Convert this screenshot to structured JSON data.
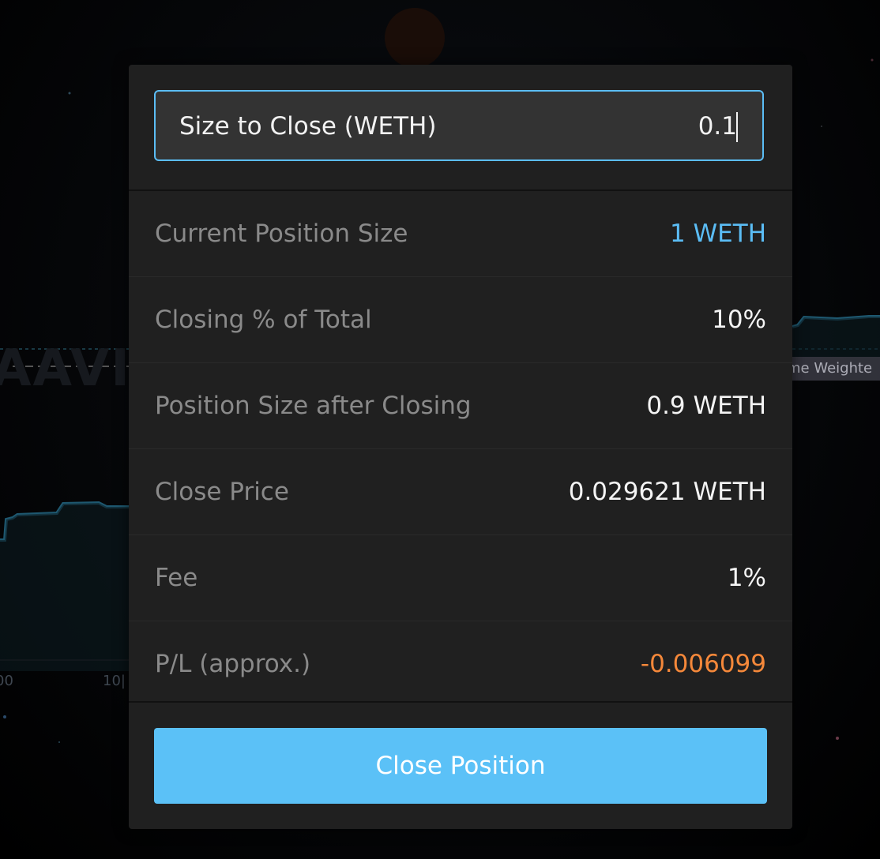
{
  "background": {
    "legend_label_partial": "me Weighte",
    "tick_labels": [
      "00",
      "10|"
    ],
    "watermark": "AAVI"
  },
  "modal": {
    "size_input": {
      "label": "Size to Close (WETH)",
      "value": "0.1"
    },
    "rows": [
      {
        "label": "Current Position Size",
        "value": "1 WETH",
        "value_color": "#5bbdf5"
      },
      {
        "label": "Closing % of Total",
        "value": "10%",
        "value_color": "#f4f4f4"
      },
      {
        "label": "Position Size after Closing",
        "value": "0.9 WETH",
        "value_color": "#f4f4f4"
      },
      {
        "label": "Close Price",
        "value": "0.029621 WETH",
        "value_color": "#f4f4f4"
      },
      {
        "label": "Fee",
        "value": "1%",
        "value_color": "#f4f4f4"
      },
      {
        "label": "P/L (approx.)",
        "value": "-0.006099",
        "value_color": "#f5883a"
      }
    ],
    "close_button_label": "Close Position"
  },
  "colors": {
    "accent": "#5bbdf5",
    "button": "#5bc1f7",
    "negative": "#f5883a",
    "modal_bg": "#202020"
  }
}
